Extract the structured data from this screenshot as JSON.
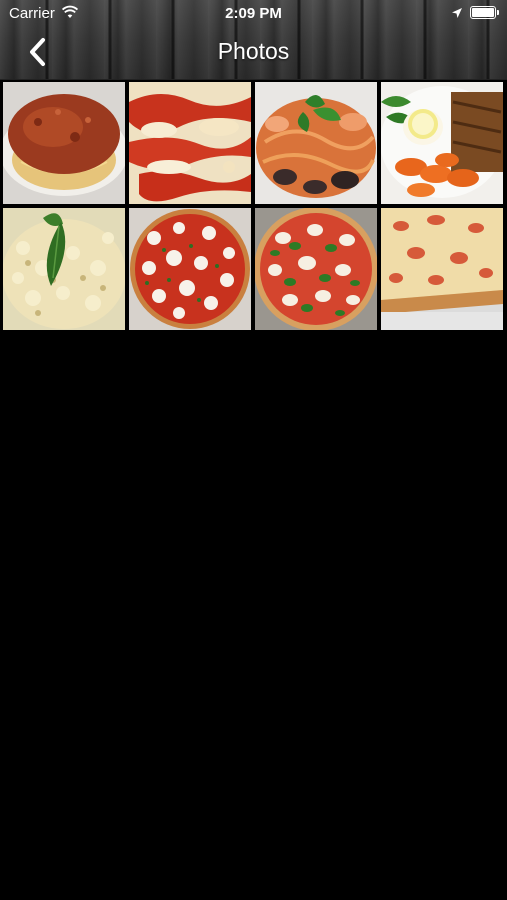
{
  "status_bar": {
    "carrier": "Carrier",
    "time": "2:09 PM",
    "wifi_icon": "wifi-icon",
    "location_icon": "location-arrow-icon",
    "battery_icon": "battery-full-icon"
  },
  "nav": {
    "title": "Photos",
    "back_icon": "chevron-left-icon"
  },
  "photos": [
    {
      "subject": "spaghetti-bolognese"
    },
    {
      "subject": "baked-pasta-with-sauce"
    },
    {
      "subject": "seafood-pasta-with-basil"
    },
    {
      "subject": "grilled-chicken-with-carrots-and-lemon"
    },
    {
      "subject": "pasta-with-basil-leaf"
    },
    {
      "subject": "margherita-pizza-spotted"
    },
    {
      "subject": "margherita-pizza-basil"
    },
    {
      "subject": "square-sicilian-pizza"
    }
  ],
  "colors": {
    "background": "#000000",
    "header": "#3a3a3a",
    "title_text": "#ffffff"
  }
}
